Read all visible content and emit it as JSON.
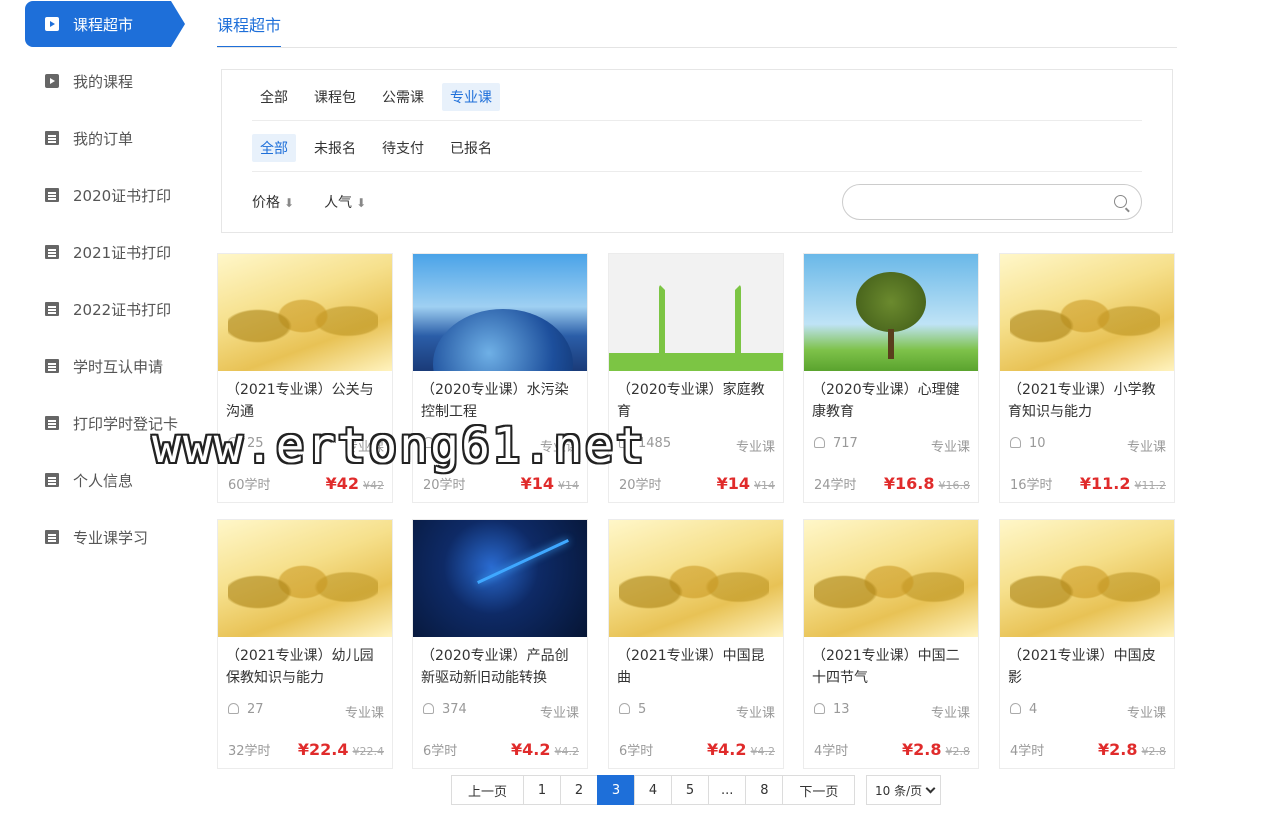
{
  "sidebar": {
    "items": [
      {
        "label": "课程超市",
        "icon": "tv-icon",
        "active": true
      },
      {
        "label": "我的课程",
        "icon": "tv-icon"
      },
      {
        "label": "我的订单",
        "icon": "clipboard-icon"
      },
      {
        "label": "2020证书打印",
        "icon": "clipboard-icon"
      },
      {
        "label": "2021证书打印",
        "icon": "clipboard-icon"
      },
      {
        "label": "2022证书打印",
        "icon": "clipboard-icon"
      },
      {
        "label": "学时互认申请",
        "icon": "document-icon"
      },
      {
        "label": "打印学时登记卡",
        "icon": "document-icon"
      },
      {
        "label": "个人信息",
        "icon": "document-icon"
      },
      {
        "label": "专业课学习",
        "icon": "document-icon"
      }
    ]
  },
  "header": {
    "tab": "课程超市"
  },
  "filters": {
    "types": [
      "全部",
      "课程包",
      "公需课",
      "专业课"
    ],
    "status": [
      "全部",
      "未报名",
      "待支付",
      "已报名"
    ],
    "sort": [
      {
        "label": "价格"
      },
      {
        "label": "人气"
      }
    ],
    "search_placeholder": ""
  },
  "courses": [
    {
      "title": "（2021专业课）公关与沟通",
      "students": "25",
      "category": "专业课",
      "hours": "60学时",
      "price": "¥42",
      "original": "¥42"
    },
    {
      "title": "（2020专业课）水污染控制工程",
      "students": "",
      "category": "专业课",
      "hours": "20学时",
      "price": "¥14",
      "original": "¥14"
    },
    {
      "title": "（2020专业课）家庭教育",
      "students": "1485",
      "category": "专业课",
      "hours": "20学时",
      "price": "¥14",
      "original": "¥14"
    },
    {
      "title": "（2020专业课）心理健康教育",
      "students": "717",
      "category": "专业课",
      "hours": "24学时",
      "price": "¥16.8",
      "original": "¥16.8"
    },
    {
      "title": "（2021专业课）小学教育知识与能力",
      "students": "10",
      "category": "专业课",
      "hours": "16学时",
      "price": "¥11.2",
      "original": "¥11.2"
    },
    {
      "title": "（2021专业课）幼儿园保教知识与能力",
      "students": "27",
      "category": "专业课",
      "hours": "32学时",
      "price": "¥22.4",
      "original": "¥22.4"
    },
    {
      "title": "（2020专业课）产品创新驱动新旧动能转换",
      "students": "374",
      "category": "专业课",
      "hours": "6学时",
      "price": "¥4.2",
      "original": "¥4.2"
    },
    {
      "title": "（2021专业课）中国昆曲",
      "students": "5",
      "category": "专业课",
      "hours": "6学时",
      "price": "¥4.2",
      "original": "¥4.2"
    },
    {
      "title": "（2021专业课）中国二十四节气",
      "students": "13",
      "category": "专业课",
      "hours": "4学时",
      "price": "¥2.8",
      "original": "¥2.8"
    },
    {
      "title": "（2021专业课）中国皮影",
      "students": "4",
      "category": "专业课",
      "hours": "4学时",
      "price": "¥2.8",
      "original": "¥2.8"
    }
  ],
  "pagination": {
    "prev": "上一页",
    "pages": [
      "1",
      "2",
      "3",
      "4",
      "5",
      "...",
      "8"
    ],
    "current": "3",
    "next": "下一页",
    "page_size": "10 条/页"
  },
  "watermark": "www.ertong61.net",
  "colors": {
    "accent": "#1e6fd9",
    "price": "#e02b2b"
  }
}
